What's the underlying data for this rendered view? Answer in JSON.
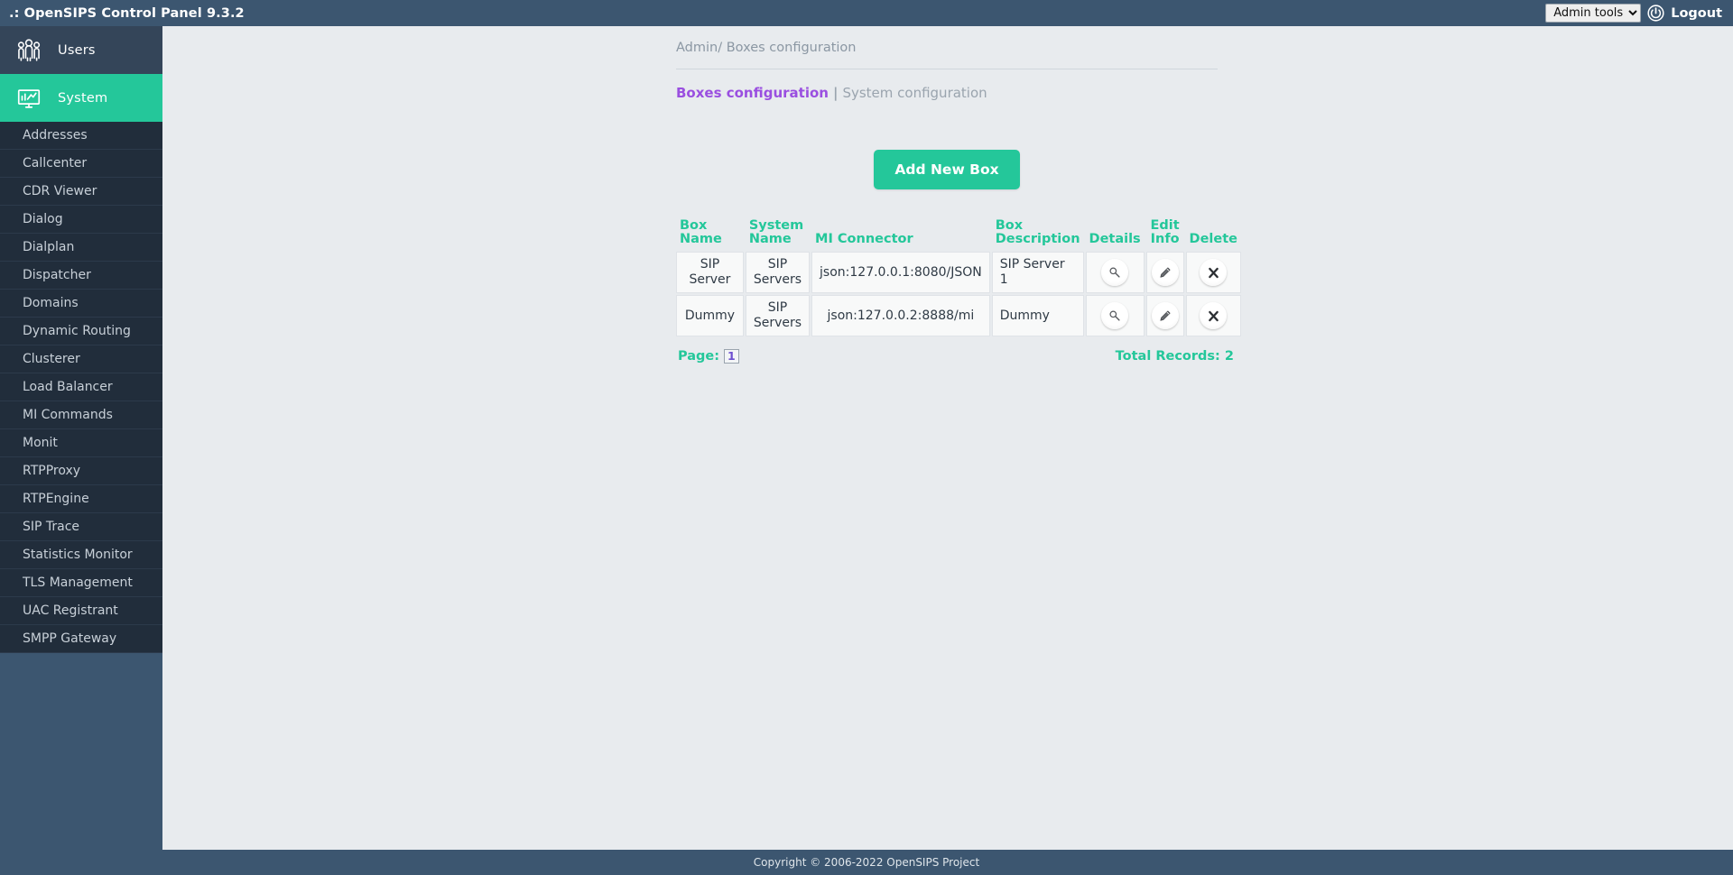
{
  "header": {
    "app_title": ".: OpenSIPS Control Panel 9.3.2",
    "admin_tools_label": "Admin tools",
    "admin_tools_options": [
      "Admin tools"
    ],
    "power_icon": "power-icon",
    "logout_label": "Logout",
    "bg_color": "#3c5670"
  },
  "sidebar": {
    "main_items": [
      {
        "label": "Users",
        "icon": "users-icon",
        "active": false
      },
      {
        "label": "System",
        "icon": "system-monitor-icon",
        "active": true
      }
    ],
    "sub_items": [
      {
        "label": "Addresses"
      },
      {
        "label": "Callcenter"
      },
      {
        "label": "CDR Viewer"
      },
      {
        "label": "Dialog"
      },
      {
        "label": "Dialplan"
      },
      {
        "label": "Dispatcher"
      },
      {
        "label": "Domains"
      },
      {
        "label": "Dynamic Routing"
      },
      {
        "label": "Clusterer"
      },
      {
        "label": "Load Balancer"
      },
      {
        "label": "MI Commands"
      },
      {
        "label": "Monit"
      },
      {
        "label": "RTPProxy"
      },
      {
        "label": "RTPEngine"
      },
      {
        "label": "SIP Trace"
      },
      {
        "label": "Statistics Monitor"
      },
      {
        "label": "TLS Management"
      },
      {
        "label": "UAC Registrant"
      },
      {
        "label": "SMPP Gateway"
      }
    ],
    "active_color": "#24c79a",
    "bg_color": "#212d3b"
  },
  "main": {
    "breadcrumb": "Admin/ Boxes configuration",
    "tabs": [
      {
        "label": "Boxes configuration",
        "active": true,
        "color": "#9a4fe0"
      },
      {
        "label": "System configuration",
        "active": false,
        "color": "#9aa4ae"
      }
    ],
    "tab_divider": "|",
    "add_button_label": "Add New Box",
    "table": {
      "columns": [
        "Box Name",
        "System Name",
        "MI Connector",
        "Box Description",
        "Details",
        "Edit Info",
        "Delete"
      ],
      "rows": [
        {
          "box_name": "SIP Server",
          "system_name": "SIP Servers",
          "mi_connector": "json:127.0.0.1:8080/JSON",
          "box_description": "SIP Server 1",
          "details_icon": "magnifier-icon",
          "edit_icon": "pencil-icon",
          "delete_icon": "cross-icon"
        },
        {
          "box_name": "Dummy",
          "system_name": "SIP Servers",
          "mi_connector": "json:127.0.0.2:8888/mi",
          "box_description": "Dummy",
          "details_icon": "magnifier-icon",
          "edit_icon": "pencil-icon",
          "delete_icon": "cross-icon"
        }
      ]
    },
    "pager": {
      "page_label": "Page:",
      "current_page": "1",
      "total_records_label": "Total Records: 2"
    }
  },
  "footer": {
    "copyright": "Copyright © 2006-2022 OpenSIPS Project"
  }
}
